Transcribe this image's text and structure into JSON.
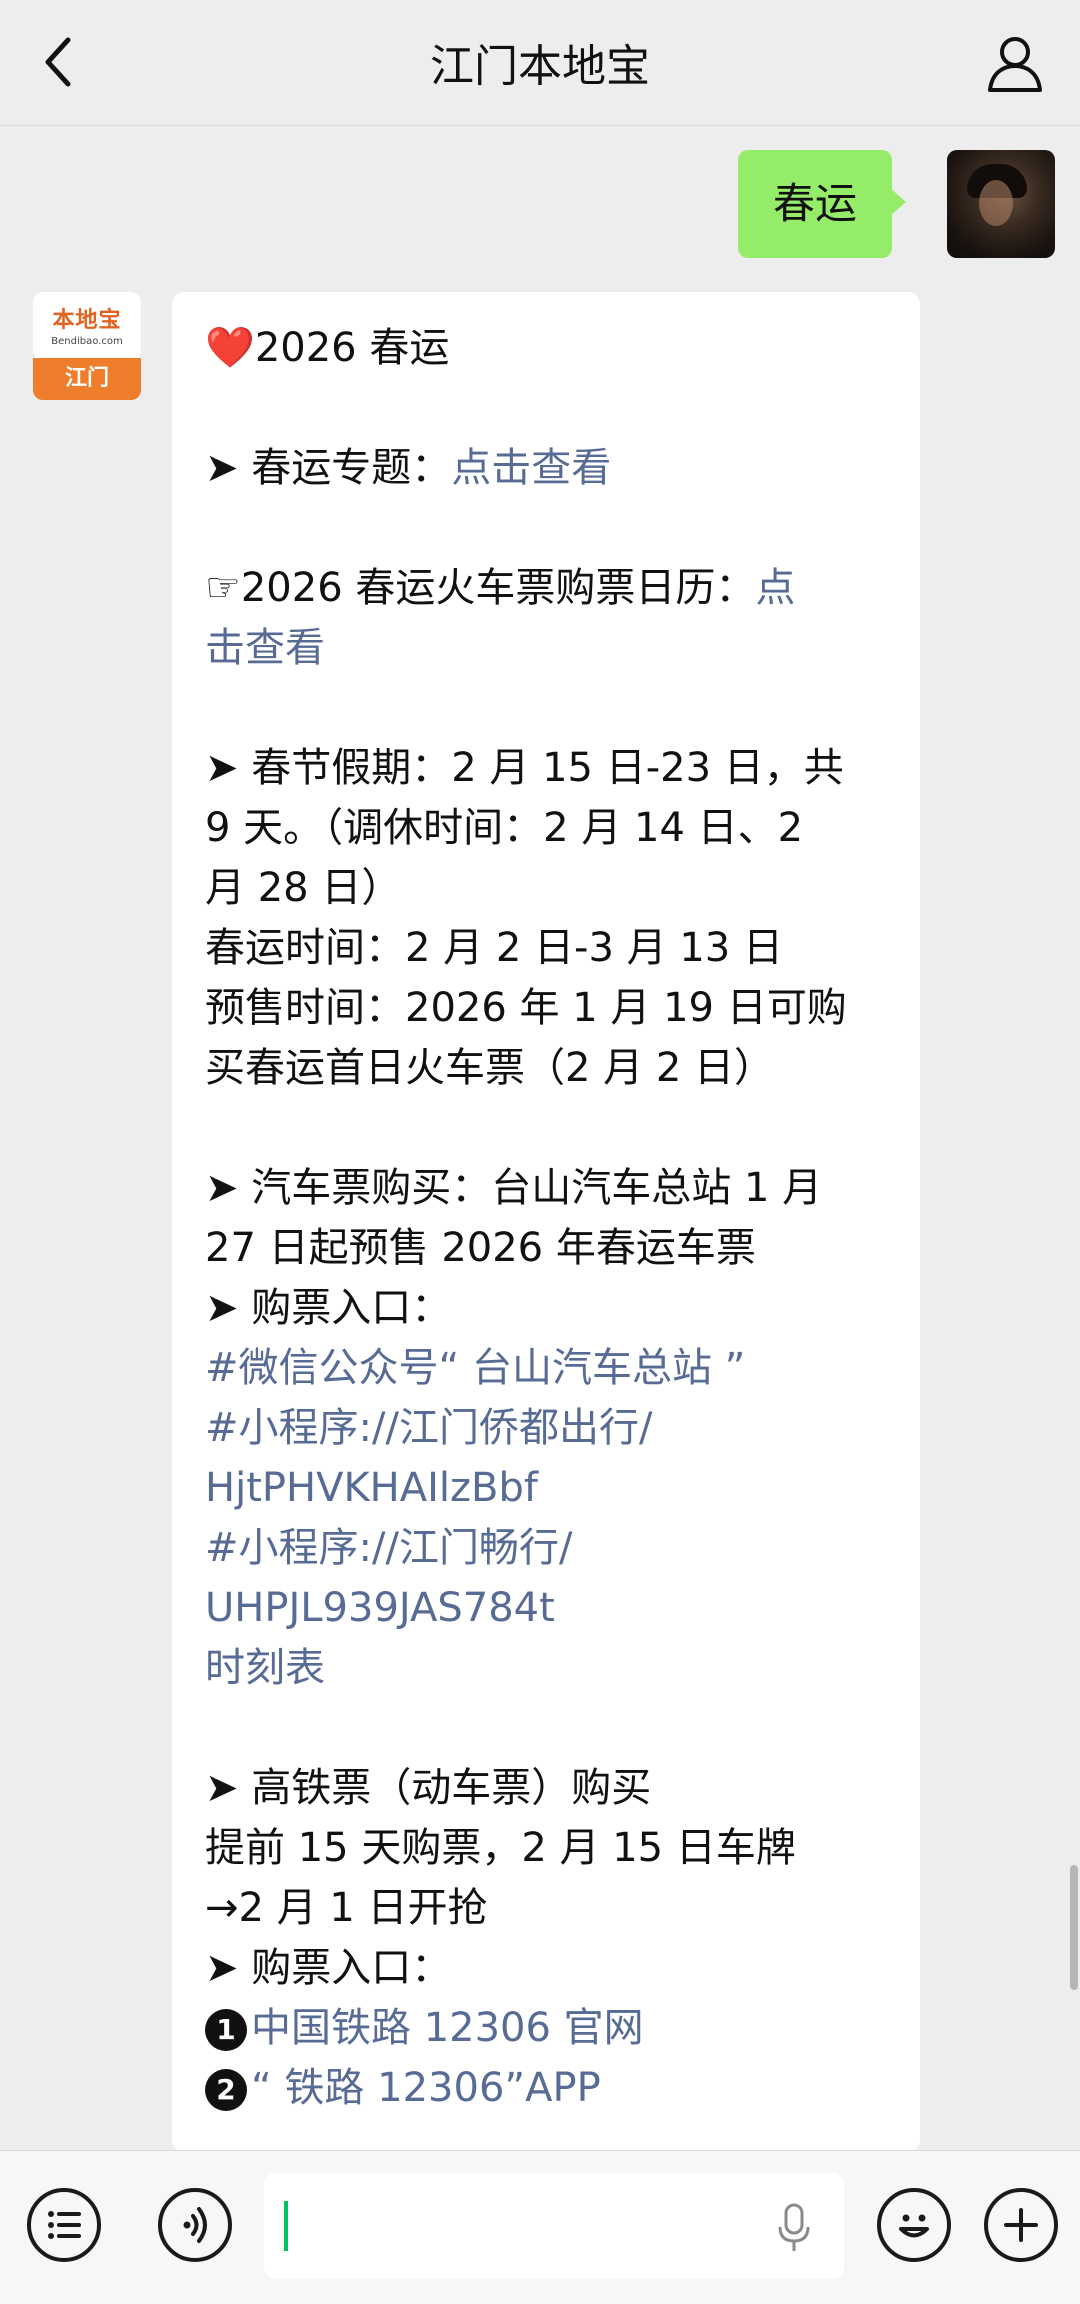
{
  "header": {
    "title": "江门本地宝"
  },
  "outgoing": {
    "text": "春运"
  },
  "bot": {
    "avatar_brand": "本地宝",
    "avatar_site": "Bendibao.com",
    "avatar_city": "江门"
  },
  "message": {
    "l1_heart": "❤️",
    "l1_text": "2026 春运",
    "l2_prefix": "➤ 春运专题：",
    "l2_link": "点击查看",
    "l3_prefix": "☞2026 春运火车票购票日历：",
    "l3_link_a": "点",
    "l3_link_b": "击查看",
    "l4": "➤ 春节假期：2 月 15 日-23 日，共",
    "l5": "9 天。（调休时间：2 月 14 日、2",
    "l6": "月 28 日）",
    "l7": "春运时间：2 月 2 日-3 月 13 日",
    "l8": "预售时间：2026 年 1 月 19 日可购",
    "l9": "买春运首日火车票（2 月 2 日）",
    "l10": "➤ 汽车票购买：台山汽车总站 1 月",
    "l11": "27 日起预售 2026 年春运车票",
    "l12": "➤ 购票入口：",
    "link1": "#微信公众号“ 台山汽车总站 ”",
    "link2a": "#小程序://江门侨都出行/",
    "link2b": "HjtPHVKHAIlzBbf",
    "link3a": "#小程序://江门畅行/",
    "link3b": "UHPJL939JAS784t",
    "link4": "时刻表",
    "l13": "➤ 高铁票（动车票）购买",
    "l14": "提前 15 天购票，2 月 15 日车牌",
    "l15": "→2 月 1 日开抢",
    "l16": "➤ 购票入口：",
    "badge1": "1",
    "link5": "中国铁路 12306 官网",
    "badge2": "2",
    "link6": "“ 铁路 12306”APP"
  },
  "icons": {
    "back": "chevron-left-icon",
    "profile": "person-icon",
    "menu": "list-icon",
    "voice": "voice-icon",
    "mic": "mic-icon",
    "emoji": "emoji-icon",
    "plus": "plus-icon"
  },
  "colors": {
    "link": "#576b95",
    "bubble_out": "#95ec69",
    "accent": "#07c160"
  }
}
